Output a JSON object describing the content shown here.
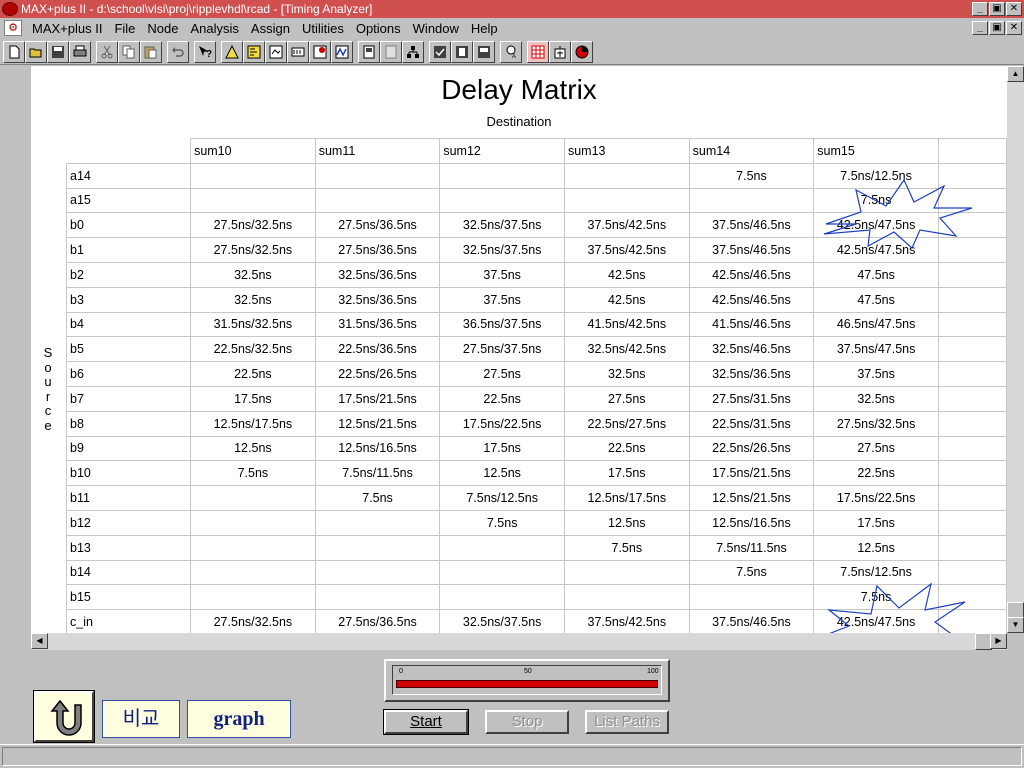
{
  "window": {
    "title": "MAX+plus II - d:\\school\\vlsi\\proj\\ripplevhdl\\rcad - [Timing Analyzer]",
    "minimize": "_",
    "restore": "▣",
    "close": "✕"
  },
  "menubar": {
    "items": [
      {
        "label": "MAX+plus II"
      },
      {
        "label": "File"
      },
      {
        "label": "Node"
      },
      {
        "label": "Analysis"
      },
      {
        "label": "Assign"
      },
      {
        "label": "Utilities"
      },
      {
        "label": "Options"
      },
      {
        "label": "Window"
      },
      {
        "label": "Help"
      }
    ]
  },
  "toolbar": {
    "icons": [
      "new-file-icon",
      "open-file-icon",
      "save-icon",
      "print-icon",
      "cut-icon",
      "copy-icon",
      "paste-icon",
      "undo-icon",
      "help-icon",
      "hierarchy-up-icon",
      "hierarchy-display-icon",
      "floorplan-icon",
      "compiler-icon",
      "simulator-icon",
      "waveform-icon",
      "timing-analyzer-icon",
      "programmer-icon",
      "message-processor-icon",
      "project-save-check-icon",
      "project-save-compile-icon",
      "project-save-simulate-icon",
      "assignment-icon",
      "matrix-icon",
      "timing-icon",
      "pie-icon"
    ]
  },
  "matrix": {
    "title": "Delay Matrix",
    "destination_label": "Destination",
    "source_label": "Source",
    "columns": [
      "sum10",
      "sum11",
      "sum12",
      "sum13",
      "sum14",
      "sum15"
    ],
    "rows": [
      {
        "label": "a14",
        "cells": [
          "",
          "",
          "",
          "",
          "7.5ns",
          "7.5ns/12.5ns"
        ]
      },
      {
        "label": "a15",
        "cells": [
          "",
          "",
          "",
          "",
          "",
          "7.5ns"
        ]
      },
      {
        "label": "b0",
        "cells": [
          "27.5ns/32.5ns",
          "27.5ns/36.5ns",
          "32.5ns/37.5ns",
          "37.5ns/42.5ns",
          "37.5ns/46.5ns",
          "42.5ns/47.5ns"
        ]
      },
      {
        "label": "b1",
        "cells": [
          "27.5ns/32.5ns",
          "27.5ns/36.5ns",
          "32.5ns/37.5ns",
          "37.5ns/42.5ns",
          "37.5ns/46.5ns",
          "42.5ns/47.5ns"
        ]
      },
      {
        "label": "b2",
        "cells": [
          "32.5ns",
          "32.5ns/36.5ns",
          "37.5ns",
          "42.5ns",
          "42.5ns/46.5ns",
          "47.5ns"
        ]
      },
      {
        "label": "b3",
        "cells": [
          "32.5ns",
          "32.5ns/36.5ns",
          "37.5ns",
          "42.5ns",
          "42.5ns/46.5ns",
          "47.5ns"
        ]
      },
      {
        "label": "b4",
        "cells": [
          "31.5ns/32.5ns",
          "31.5ns/36.5ns",
          "36.5ns/37.5ns",
          "41.5ns/42.5ns",
          "41.5ns/46.5ns",
          "46.5ns/47.5ns"
        ]
      },
      {
        "label": "b5",
        "cells": [
          "22.5ns/32.5ns",
          "22.5ns/36.5ns",
          "27.5ns/37.5ns",
          "32.5ns/42.5ns",
          "32.5ns/46.5ns",
          "37.5ns/47.5ns"
        ]
      },
      {
        "label": "b6",
        "cells": [
          "22.5ns",
          "22.5ns/26.5ns",
          "27.5ns",
          "32.5ns",
          "32.5ns/36.5ns",
          "37.5ns"
        ]
      },
      {
        "label": "b7",
        "cells": [
          "17.5ns",
          "17.5ns/21.5ns",
          "22.5ns",
          "27.5ns",
          "27.5ns/31.5ns",
          "32.5ns"
        ]
      },
      {
        "label": "b8",
        "cells": [
          "12.5ns/17.5ns",
          "12.5ns/21.5ns",
          "17.5ns/22.5ns",
          "22.5ns/27.5ns",
          "22.5ns/31.5ns",
          "27.5ns/32.5ns"
        ]
      },
      {
        "label": "b9",
        "cells": [
          "12.5ns",
          "12.5ns/16.5ns",
          "17.5ns",
          "22.5ns",
          "22.5ns/26.5ns",
          "27.5ns"
        ]
      },
      {
        "label": "b10",
        "cells": [
          "7.5ns",
          "7.5ns/11.5ns",
          "12.5ns",
          "17.5ns",
          "17.5ns/21.5ns",
          "22.5ns"
        ]
      },
      {
        "label": "b11",
        "cells": [
          "",
          "7.5ns",
          "7.5ns/12.5ns",
          "12.5ns/17.5ns",
          "12.5ns/21.5ns",
          "17.5ns/22.5ns"
        ]
      },
      {
        "label": "b12",
        "cells": [
          "",
          "",
          "7.5ns",
          "12.5ns",
          "12.5ns/16.5ns",
          "17.5ns"
        ]
      },
      {
        "label": "b13",
        "cells": [
          "",
          "",
          "",
          "7.5ns",
          "7.5ns/11.5ns",
          "12.5ns"
        ]
      },
      {
        "label": "b14",
        "cells": [
          "",
          "",
          "",
          "",
          "7.5ns",
          "7.5ns/12.5ns"
        ]
      },
      {
        "label": "b15",
        "cells": [
          "",
          "",
          "",
          "",
          "",
          "7.5ns"
        ]
      },
      {
        "label": "c_in",
        "cells": [
          "27.5ns/32.5ns",
          "27.5ns/36.5ns",
          "32.5ns/37.5ns",
          "37.5ns/42.5ns",
          "37.5ns/46.5ns",
          "42.5ns/47.5ns"
        ]
      }
    ]
  },
  "progress": {
    "tick_min": "0",
    "tick_mid": "50",
    "tick_max": "100",
    "value_percent": 100,
    "bar_color": "#d00000"
  },
  "buttons": {
    "start": "Start",
    "stop": "Stop",
    "list_paths": "List Paths",
    "back_icon": "return-arrow-icon",
    "compare_label": "비교",
    "graph_label": "graph"
  },
  "colors": {
    "title_bar": "#d05050",
    "highlight_star": "#2040c0"
  }
}
